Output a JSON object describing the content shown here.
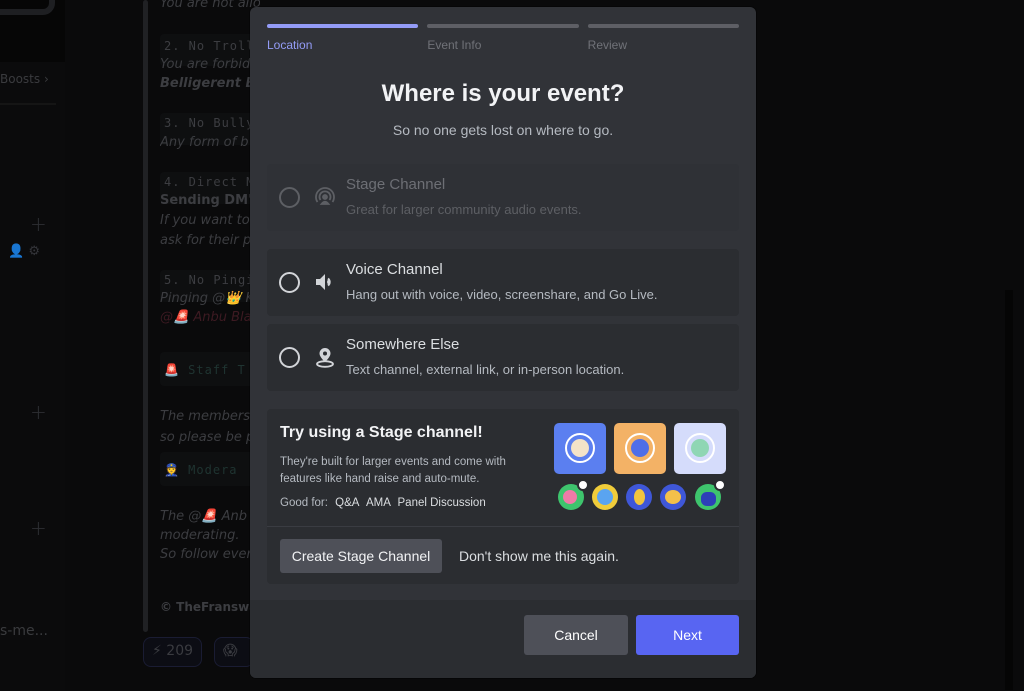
{
  "background": {
    "sidebar": {
      "boosts_label": "Boosts",
      "channel_truncated": "s-me..."
    },
    "message": {
      "lines": [
        {
          "text": "You are not allowed to self-advertise in this server.",
          "style": "italic"
        },
        {
          "text": "2. No Troll",
          "style": "mono"
        },
        {
          "text": "You are forbid",
          "style": "italic"
        },
        {
          "text": "Belligerent Be",
          "style": "bold-italic"
        },
        {
          "text": "3. No Bully",
          "style": "mono"
        },
        {
          "text": "Any form of b",
          "style": "italic"
        },
        {
          "text": "4. Direct M",
          "style": "mono"
        },
        {
          "text": "Sending DM's",
          "style": "bold"
        },
        {
          "text": "If you want to",
          "style": "italic"
        },
        {
          "text": "ask for their p",
          "style": "italic"
        },
        {
          "text": "5. No Pingi",
          "style": "mono"
        },
        {
          "text": "Pinging @👑 K",
          "style": "italic"
        },
        {
          "text": "@🚨 Anbu Bla",
          "style": "mention"
        },
        {
          "text": "🚨 Staff T",
          "style": "code"
        },
        {
          "text": "The members",
          "style": "italic"
        },
        {
          "text": "so please be p",
          "style": "italic"
        },
        {
          "text": "👮 Modera",
          "style": "code"
        },
        {
          "text": "The @🚨 Anb",
          "style": "italic"
        },
        {
          "text": "moderating.",
          "style": "italic"
        },
        {
          "text": "So follow every",
          "style": "italic"
        },
        {
          "text": "© TheFranswah",
          "style": "bold-dim"
        }
      ],
      "reactions": [
        {
          "emoji": "⚡",
          "count": "209"
        },
        {
          "emoji": "😱",
          "count": ""
        }
      ]
    }
  },
  "modal": {
    "steps": [
      {
        "label": "Location",
        "active": true
      },
      {
        "label": "Event Info",
        "active": false
      },
      {
        "label": "Review",
        "active": false
      }
    ],
    "title": "Where is your event?",
    "subtitle": "So no one gets lost on where to go.",
    "options": [
      {
        "name": "Stage Channel",
        "description": "Great for larger community audio events.",
        "icon": "stage-icon",
        "disabled": true,
        "selected": false
      },
      {
        "name": "Voice Channel",
        "description": "Hang out with voice, video, screenshare, and Go Live.",
        "icon": "speaker-icon",
        "disabled": false,
        "selected": false
      },
      {
        "name": "Somewhere Else",
        "description": "Text channel, external link, or in-person location.",
        "icon": "location-pin-icon",
        "disabled": false,
        "selected": false
      }
    ],
    "promo": {
      "title": "Try using a Stage channel!",
      "description": "They're built for larger events and come with features like hand raise and auto-mute.",
      "good_for_label": "Good for:",
      "good_for_tags": [
        "Q&A",
        "AMA",
        "Panel Discussion"
      ],
      "create_button": "Create Stage Channel",
      "dismiss_link": "Don't show me this again.",
      "speaker_tiles": [
        {
          "color": "#5b7ff0",
          "face": "#f3c6a0"
        },
        {
          "color": "#f3b266",
          "face": "#4f6ee8"
        },
        {
          "color": "#d5dcfb",
          "face": "#8fd6b4"
        }
      ],
      "audience": [
        {
          "color": "#3ec46d",
          "hand_raised": true
        },
        {
          "color": "#f0cc3a",
          "hand_raised": false
        },
        {
          "color": "#3f57d8",
          "hand_raised": false
        },
        {
          "color": "#3f57d8",
          "hand_raised": false
        },
        {
          "color": "#3ec46d",
          "hand_raised": true
        }
      ]
    },
    "footer": {
      "cancel": "Cancel",
      "next": "Next"
    },
    "colors": {
      "accent": "#5865f2",
      "step_active": "#949cf7"
    }
  }
}
